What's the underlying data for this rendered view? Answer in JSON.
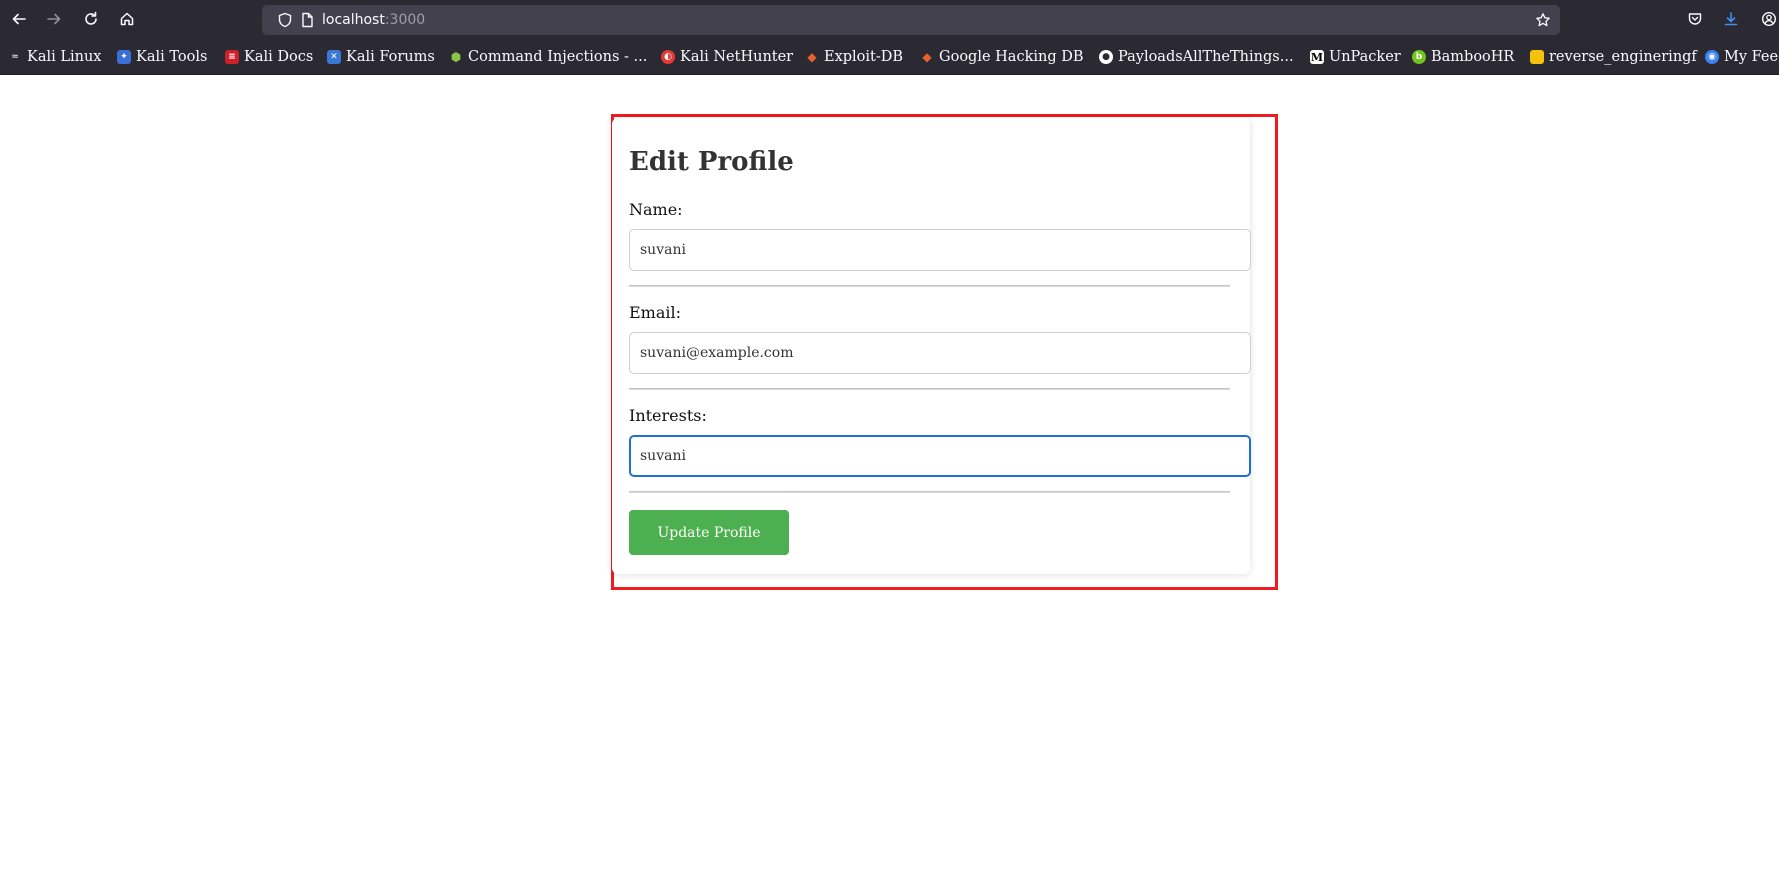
{
  "browser": {
    "url_host": "localhost",
    "url_port": ":3000",
    "bookmarks": [
      {
        "label": "Kali Linux",
        "icon": "kali-dragon-icon",
        "color": "#2b2a33"
      },
      {
        "label": "Kali Tools",
        "icon": "kali-tools-icon",
        "color": "#3b6fd6"
      },
      {
        "label": "Kali Docs",
        "icon": "kali-docs-icon",
        "color": "#d0202a"
      },
      {
        "label": "Kali Forums",
        "icon": "kali-forums-icon",
        "color": "#3a78d8"
      },
      {
        "label": "Command Injections - ...",
        "icon": "hexagon-icon",
        "color": "#8bc34a"
      },
      {
        "label": "Kali NetHunter",
        "icon": "nethunter-icon",
        "color": "#e53935"
      },
      {
        "label": "Exploit-DB",
        "icon": "exploit-db-icon",
        "color": "#e8612c"
      },
      {
        "label": "Google Hacking DB",
        "icon": "ghdb-icon",
        "color": "#e8612c"
      },
      {
        "label": "PayloadsAllTheThings...",
        "icon": "github-icon",
        "color": "#ffffff"
      },
      {
        "label": "UnPacker",
        "icon": "unpacker-icon",
        "color": "#ffffff"
      },
      {
        "label": "BambooHR",
        "icon": "bamboohr-icon",
        "color": "#73c41d"
      },
      {
        "label": "reverse_engineringf",
        "icon": "folder-icon",
        "color": "#f4c20d"
      },
      {
        "label": "My Feed",
        "icon": "feed-icon",
        "color": "#3b82f6"
      }
    ]
  },
  "form": {
    "title": "Edit Profile",
    "name_label": "Name:",
    "name_value": "suvani",
    "email_label": "Email:",
    "email_value": "suvani@example.com",
    "interests_label": "Interests:",
    "interests_value": "suvani",
    "submit_label": "Update Profile"
  },
  "colors": {
    "highlight": "#ee1c1c",
    "button": "#4caf50",
    "focus": "#1f6fd8"
  }
}
